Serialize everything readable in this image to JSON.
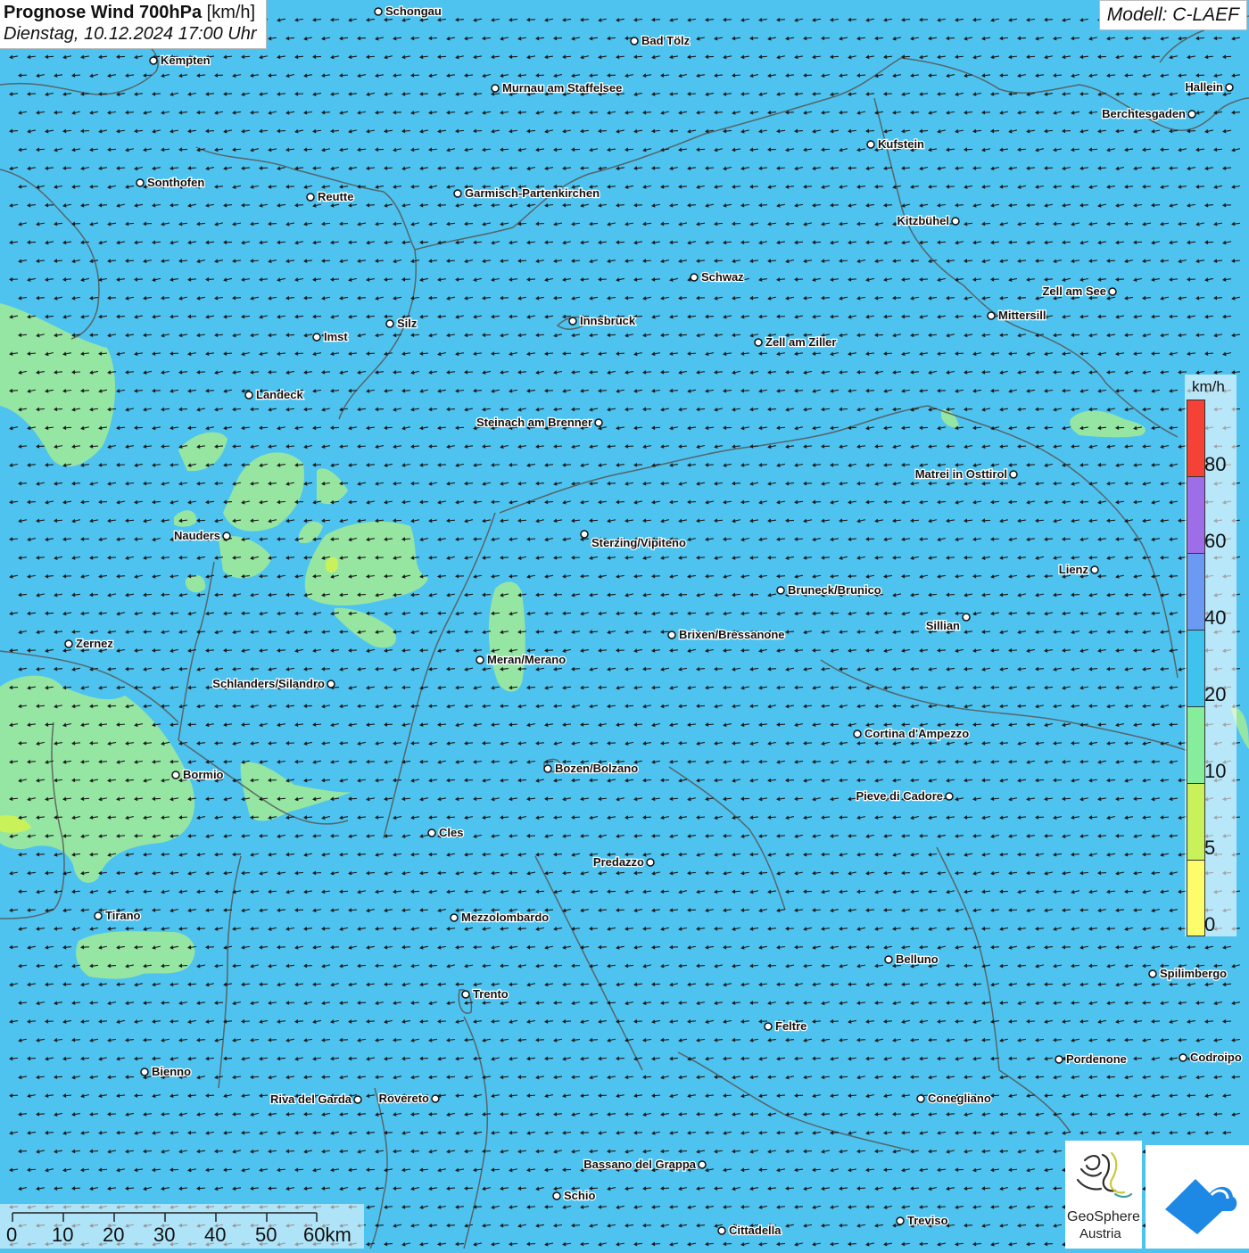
{
  "title": {
    "main": "Prognose Wind 700hPa",
    "unit": "[km/h]",
    "date": "Dienstag, 10.12.2024 17:00 Uhr"
  },
  "model": "Modell: C-LAEF",
  "legend": {
    "unit": "km/h",
    "labels": [
      "80",
      "60",
      "40",
      "20",
      "10",
      "5",
      "0"
    ],
    "colors": [
      "#f44336",
      "#9e6de8",
      "#6a9af2",
      "#3ec3ef",
      "#86ee9a",
      "#c9f25a",
      "#fdfd6c"
    ]
  },
  "scalebar": {
    "labels": [
      "0",
      "10",
      "20",
      "30",
      "40",
      "50",
      "60km"
    ]
  },
  "logo": {
    "line1": "GeoSphere",
    "line2": "Austria"
  },
  "colors": {
    "background": "#4fc3ef",
    "green_area": "#9ae89e",
    "border": "#555555",
    "arrow": "#1a1a1a"
  },
  "cities": [
    "Schongau",
    "Bad Tölz",
    "Kempten",
    "Murnau am Staffelsee",
    "Hallein",
    "Berchtesgaden",
    "Kufstein",
    "Sonthofen",
    "Reutte",
    "Garmisch-Partenkirchen",
    "Kitzbühel",
    "Schwaz",
    "Zell am See",
    "Innsbruck",
    "Mittersill",
    "Silz",
    "Imst",
    "Zell am Ziller",
    "Landeck",
    "Steinach am Brenner",
    "Matrei in Osttirol",
    "Nauders",
    "Sterzing/Vipiteno",
    "Lienz",
    "Bruneck/Brunico",
    "Sillian",
    "Zernez",
    "Brixen/Bressanone",
    "Meran/Merano",
    "Schlanders/Silandro",
    "Cortina d'Ampezzo",
    "Bozen/Bolzano",
    "Bormio",
    "Pieve di Cadore",
    "Cles",
    "Predazzo",
    "Tirano",
    "Mezzolombardo",
    "Belluno",
    "Spilimbergo",
    "Trento",
    "Feltre",
    "Pordenone",
    "Codroipo",
    "Bienno",
    "Riva del Garda",
    "Rovereto",
    "Conegliano",
    "Bassano del Grappa",
    "Schio",
    "Treviso",
    "Cittadella"
  ]
}
